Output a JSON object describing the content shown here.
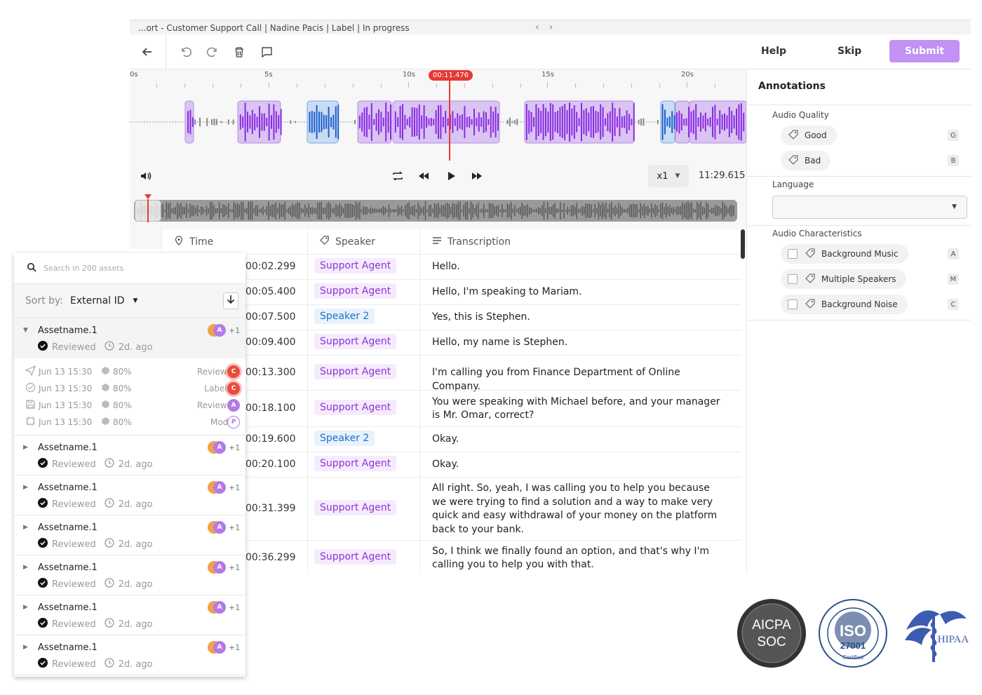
{
  "window_title": "...ort - Customer Support Call | Nadine Pacis | Label | In progress",
  "toolbar": {
    "help": "Help",
    "skip": "Skip",
    "submit": "Submit"
  },
  "timeline": {
    "tick_labels": [
      "0s",
      "5s",
      "10s",
      "15s",
      "20s"
    ],
    "playhead_time": "00:11.476",
    "speed": "x1",
    "duration": "11:29.615"
  },
  "annotations": {
    "title": "Annotations",
    "audio_quality": {
      "label": "Audio Quality",
      "options": [
        {
          "label": "Good",
          "key": "G"
        },
        {
          "label": "Bad",
          "key": "B"
        }
      ]
    },
    "language": {
      "label": "Language",
      "value": ""
    },
    "audio_characteristics": {
      "label": "Audio Characteristics",
      "options": [
        {
          "label": "Background Music",
          "key": "A"
        },
        {
          "label": "Multiple Speakers",
          "key": "M"
        },
        {
          "label": "Background Noise",
          "key": "C"
        }
      ]
    }
  },
  "table": {
    "headers": {
      "time": "Time",
      "speaker": "Speaker",
      "transcription": "Transcription"
    },
    "rows": [
      {
        "time": "00:02.299",
        "speaker": "Support Agent",
        "text": "Hello."
      },
      {
        "time": "00:05.400",
        "speaker": "Support Agent",
        "text": "Hello, I'm speaking to Mariam."
      },
      {
        "time": "00:07.500",
        "speaker": "Speaker 2",
        "text": "Yes, this is Stephen."
      },
      {
        "time": "00:09.400",
        "speaker": "Support Agent",
        "text": "Hello, my name is Stephen."
      },
      {
        "time": "00:13.300",
        "speaker": "Support Agent",
        "text": "I'm calling you from Finance Department of Online Company."
      },
      {
        "time": "00:18.100",
        "speaker": "Support Agent",
        "text": "You were speaking with Michael before, and your manager is Mr. Omar, correct?"
      },
      {
        "time": "00:19.600",
        "speaker": "Speaker 2",
        "text": "Okay."
      },
      {
        "time": "00:20.100",
        "speaker": "Support Agent",
        "text": "Okay."
      },
      {
        "time": "00:31.399",
        "speaker": "Support Agent",
        "text": "All right. So, yeah, I was calling you to help you because we were trying to find a solution and a way to make very quick and easy withdrawal of your money on the platform back to your bank."
      },
      {
        "time": "00:36.299",
        "speaker": "Support Agent",
        "text": "So, I think we finally found an option, and that's why I'm calling you to help you with that."
      }
    ]
  },
  "assets_panel": {
    "search_placeholder": "Search in 200 assets",
    "sort_label": "Sort by:",
    "sort_value": "External ID",
    "expanded": {
      "name": "Assetname.1",
      "status": "Reviewed",
      "age": "2d. ago",
      "more": "+1",
      "history": [
        {
          "date": "Jun 13 15:30",
          "pct": "80%",
          "role": "Reviewer",
          "avatar": "C"
        },
        {
          "date": "Jun 13 15:30",
          "pct": "80%",
          "role": "Labeler",
          "avatar": "C"
        },
        {
          "date": "Jun 13 15:30",
          "pct": "80%",
          "role": "Reviewer",
          "avatar": "A"
        },
        {
          "date": "Jun 13 15:30",
          "pct": "80%",
          "role": "Model",
          "avatar": "P"
        }
      ]
    },
    "items": [
      {
        "name": "Assetname.1",
        "status": "Reviewed",
        "age": "2d. ago",
        "more": "+1"
      },
      {
        "name": "Assetname.1",
        "status": "Reviewed",
        "age": "2d. ago",
        "more": "+1"
      },
      {
        "name": "Assetname.1",
        "status": "Reviewed",
        "age": "2d. ago",
        "more": "+1"
      },
      {
        "name": "Assetname.1",
        "status": "Reviewed",
        "age": "2d. ago",
        "more": "+1"
      },
      {
        "name": "Assetname.1",
        "status": "Reviewed",
        "age": "2d. ago",
        "more": "+1"
      },
      {
        "name": "Assetname.1",
        "status": "Reviewed",
        "age": "2d. ago",
        "more": "+1"
      }
    ]
  },
  "badges": {
    "aicpa": {
      "line1": "AICPA",
      "line2": "SOC"
    },
    "iso": {
      "line1": "ISO",
      "line2": "27001",
      "line3": "Certified"
    },
    "hipaa": "HIPAA"
  },
  "colors": {
    "accent": "#c191f4",
    "agent": "#8e34d6",
    "speaker2": "#1d6fc8",
    "playhead": "#e53935"
  }
}
